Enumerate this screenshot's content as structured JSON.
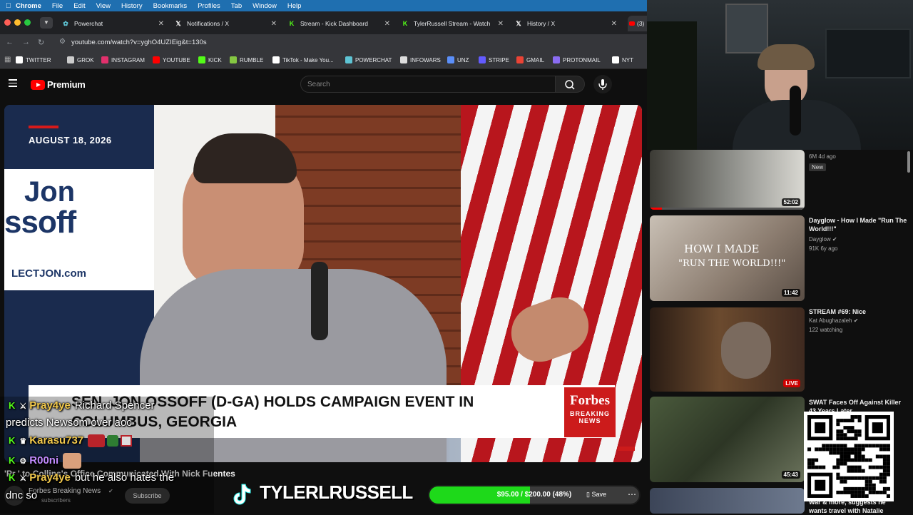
{
  "menubar": {
    "items": [
      "Chrome",
      "File",
      "Edit",
      "View",
      "History",
      "Bookmarks",
      "Profiles",
      "Tab",
      "Window",
      "Help"
    ]
  },
  "tabs": [
    {
      "label": "Powerchat",
      "icon": "powerchat-icon"
    },
    {
      "label": "Notifications / X",
      "icon": "x-icon"
    },
    {
      "label": "Stream - Kick Dashboard",
      "icon": "kick-icon"
    },
    {
      "label": "TylerRussell Stream - Watch L",
      "icon": "kick-icon"
    },
    {
      "label": "History / X",
      "icon": "x-icon"
    },
    {
      "label": "(3)",
      "icon": "youtube-icon"
    }
  ],
  "address": {
    "url": "youtube.com/watch?v=yghO4UZIEig&t=130s"
  },
  "bookmarks": [
    {
      "label": "TWITTER",
      "icon": "x-icon",
      "color": "#ffffff"
    },
    {
      "label": "GROK",
      "icon": "grok-icon",
      "color": "#cccccc"
    },
    {
      "label": "INSTAGRAM",
      "icon": "instagram-icon",
      "color": "#e1306c"
    },
    {
      "label": "YOUTUBE",
      "icon": "youtube-icon",
      "color": "#ff0000"
    },
    {
      "label": "KICK",
      "icon": "kick-icon",
      "color": "#53fc18"
    },
    {
      "label": "RUMBLE",
      "icon": "rumble-icon",
      "color": "#85c742"
    },
    {
      "label": "TikTok - Make You...",
      "icon": "tiktok-icon",
      "color": "#ffffff"
    },
    {
      "label": "POWERCHAT",
      "icon": "powerchat-icon",
      "color": "#5ec4d4"
    },
    {
      "label": "INFOWARS",
      "icon": "infowars-icon",
      "color": "#dddddd"
    },
    {
      "label": "UNZ",
      "icon": "unz-icon",
      "color": "#5b8ff9"
    },
    {
      "label": "STRIPE",
      "icon": "stripe-icon",
      "color": "#635bff"
    },
    {
      "label": "GMAIL",
      "icon": "gmail-icon",
      "color": "#ea4335"
    },
    {
      "label": "PROTONMAIL",
      "icon": "protonmail-icon",
      "color": "#8a6cf2"
    },
    {
      "label": "NYT",
      "icon": "nyt-icon",
      "color": "#ffffff"
    }
  ],
  "youtube": {
    "brand": "Premium",
    "search_placeholder": "Search"
  },
  "video": {
    "date": "AUGUST 18, 2026",
    "backdrop": {
      "sign_name": "Jon",
      "sign_surname": "ssoff",
      "sign_url": "LECTJON.com"
    },
    "lower_third_line1": "SEN. JON OSSOFF (D-GA) HOLDS CAMPAIGN EVENT IN",
    "lower_third_line2": "COLUMBUS, GEORGIA",
    "forbes_brand": "Forbes",
    "forbes_tag1": "BREAKING",
    "forbes_tag2": "NEWS",
    "title": "'Pr         ' to Collins's Office Communicated With Nick Fuentes",
    "channel": "Forbes Breaking News",
    "subscribers": "subscribers",
    "subscribe_label": "Subscribe",
    "save_label": "Save"
  },
  "chat": [
    {
      "user": "Pray4ye",
      "message": "Richard Spencer",
      "user_color": "#f2c94c"
    },
    {
      "user": "",
      "message": "predicts Newsom over aoc",
      "user_color": "#ffffff"
    },
    {
      "user": "Karasu737",
      "message": "",
      "user_color": "#f2c94c"
    },
    {
      "user": "R00ni",
      "message": "",
      "user_color": "#c38bff"
    },
    {
      "user": "Pray4ye",
      "message": "but he also hates the",
      "user_color": "#f2c94c"
    },
    {
      "user": "",
      "message": "dnc so",
      "user_color": "#ffffff"
    }
  ],
  "overlay": {
    "tiktok_handle": "TYLERLRUSSELL",
    "goal_text": "$95.00 / $200.00 (48%)",
    "goal_fraction": 0.48,
    "goal_color": "#1ed91a"
  },
  "recommendations": [
    {
      "title": "",
      "channel": "",
      "meta": "6M  4d ago",
      "badge": "New",
      "duration": "52:02"
    },
    {
      "title": "Dayglow - How I Made \"Run The World!!!\"",
      "channel": "Dayglow",
      "meta": "91K  6y ago",
      "badge": "",
      "duration": "11:42",
      "thumb_text1": "HOW I MADE",
      "thumb_text2": "\"RUN THE WORLD!!!\""
    },
    {
      "title": "STREAM #69: Nice",
      "channel": "Kat Abughazaleh",
      "meta": "122 watching",
      "badge": "",
      "duration": "LIVE"
    },
    {
      "title": "SWAT Faces Off Against Killer 43 Years Later",
      "channel": "",
      "meta": "",
      "badge": "",
      "duration": "45:43"
    },
    {
      "title": "War & more, suggests he wants travel with Natalie",
      "channel": "",
      "meta": "",
      "badge": "",
      "duration": ""
    }
  ]
}
